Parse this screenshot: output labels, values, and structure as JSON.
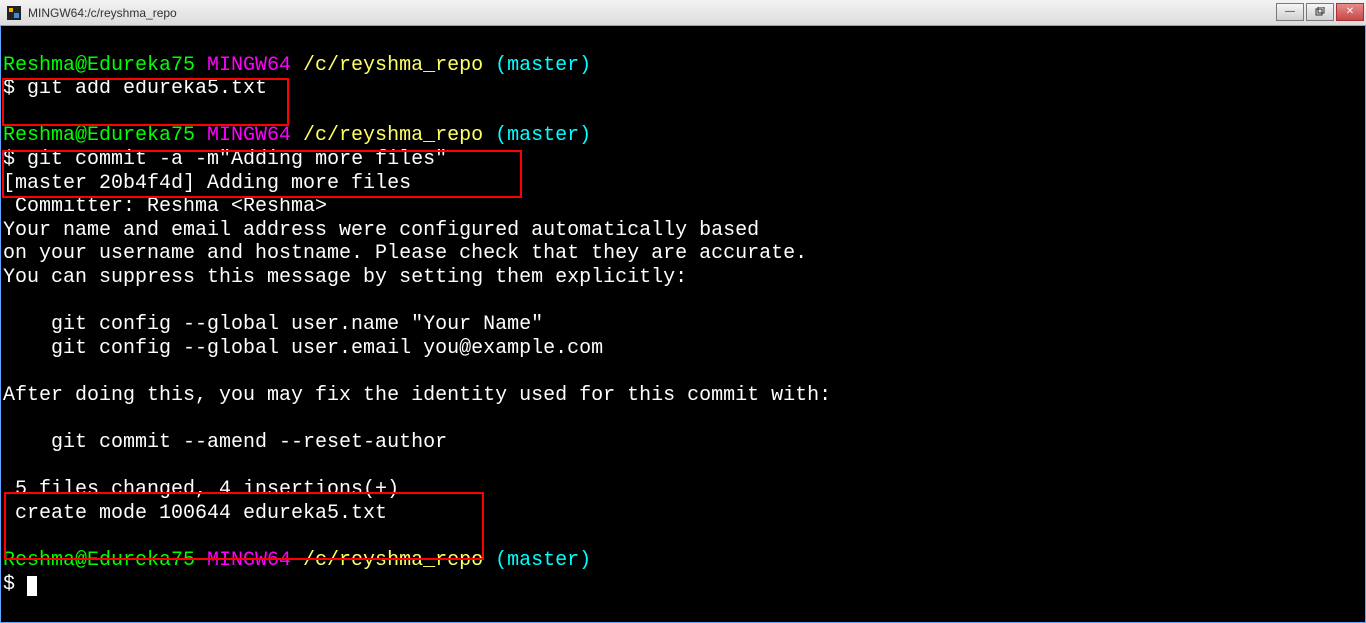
{
  "titlebar": {
    "title": "MINGW64:/c/reyshma_repo"
  },
  "prompt1": {
    "user": "Reshma@Edureka75",
    "env": " MINGW64",
    "path": " /c/reyshma_repo",
    "branch": " (master)",
    "ps": "$ ",
    "cmd": "git add edureka5.txt"
  },
  "prompt2": {
    "user": "Reshma@Edureka75",
    "env": " MINGW64",
    "path": " /c/reyshma_repo",
    "branch": " (master)",
    "ps": "$ ",
    "cmd": "git commit -a -m\"Adding more files\""
  },
  "out1": "[master 20b4f4d] Adding more files",
  "out2": " Committer: Reshma <Reshma>",
  "out3": "Your name and email address were configured automatically based",
  "out4": "on your username and hostname. Please check that they are accurate.",
  "out5": "You can suppress this message by setting them explicitly:",
  "out6": "    git config --global user.name \"Your Name\"",
  "out7": "    git config --global user.email you@example.com",
  "out8": "After doing this, you may fix the identity used for this commit with:",
  "out9": "    git commit --amend --reset-author",
  "out10": " 5 files changed, 4 insertions(+)",
  "out11": " create mode 100644 edureka5.txt",
  "prompt3": {
    "user": "Reshma@Edureka75",
    "env": " MINGW64",
    "path": " /c/reyshma_repo",
    "branch": " (master)",
    "ps": "$ "
  }
}
